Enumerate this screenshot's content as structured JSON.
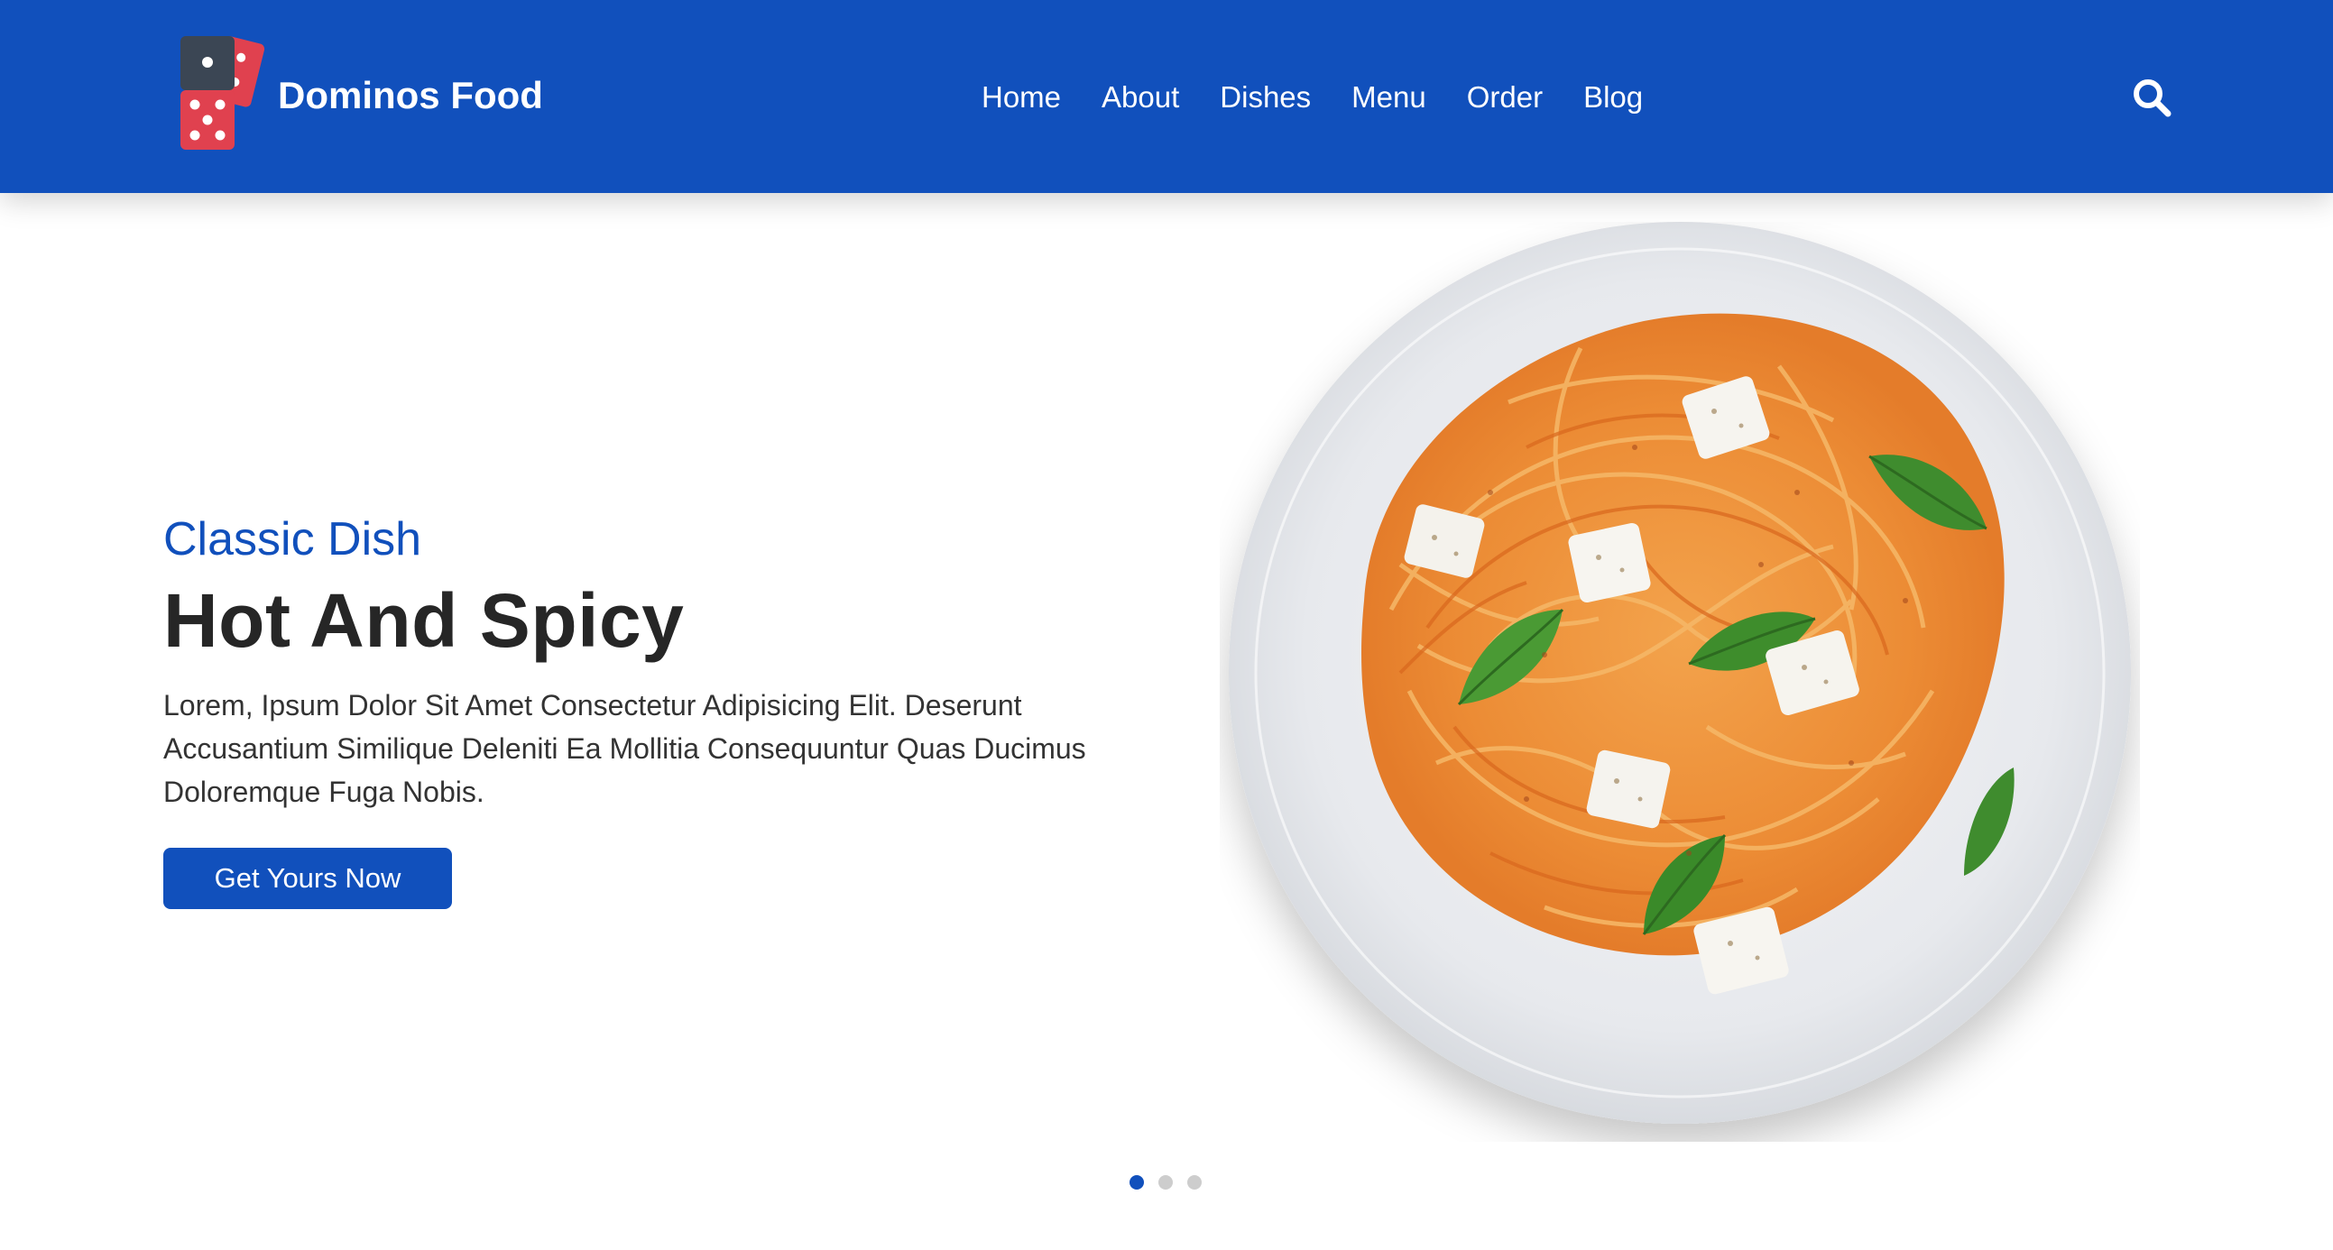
{
  "brand": {
    "name": "Dominos Food",
    "logo_icon": "domino-icon"
  },
  "nav": {
    "items": [
      {
        "label": "Home"
      },
      {
        "label": "About"
      },
      {
        "label": "Dishes"
      },
      {
        "label": "Menu"
      },
      {
        "label": "Order"
      },
      {
        "label": "Blog"
      }
    ],
    "search_icon": "search-icon"
  },
  "hero": {
    "subtitle": "Classic Dish",
    "title": "Hot And Spicy",
    "description": "Lorem, Ipsum Dolor Sit Amet Consectetur Adipisicing Elit. Deserunt Accusantium Similique Deleniti Ea Mollitia Consequuntur Quas Ducimus Doloremque Fuga Nobis.",
    "cta_label": "Get Yours Now",
    "image": "spaghetti-plate-image"
  },
  "slider": {
    "count": 3,
    "active": 1
  },
  "colors": {
    "primary": "#1150bc",
    "domino_dark": "#3b4654",
    "domino_red": "#e0414f"
  }
}
